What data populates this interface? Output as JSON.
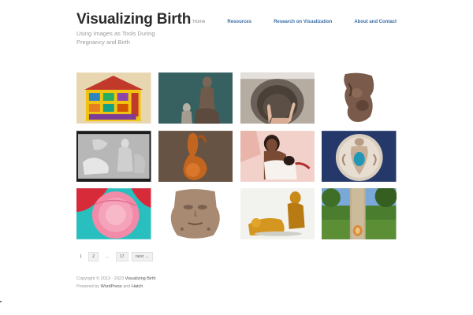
{
  "site": {
    "title": "Visualizing Birth",
    "tagline": "Using Images as Tools During Pregnancy and Birth"
  },
  "nav": {
    "items": [
      {
        "label": "Home"
      },
      {
        "label": "Resources"
      },
      {
        "label": "Research on Visualization"
      },
      {
        "label": "About and Contact"
      }
    ]
  },
  "gallery": {
    "images": [
      {
        "name": "colorful-folk-house-painting"
      },
      {
        "name": "figure-sculptures-teal-background"
      },
      {
        "name": "hand-and-clay-vessel"
      },
      {
        "name": "carved-wooden-torso"
      },
      {
        "name": "stone-relief-carving"
      },
      {
        "name": "polished-wood-abstract-figure"
      },
      {
        "name": "painted-breastfeeding-mother"
      },
      {
        "name": "ceramic-plate-figure-blue-center"
      },
      {
        "name": "pink-circle-painting"
      },
      {
        "name": "carved-stone-head-vessel"
      },
      {
        "name": "gold-figures-sculpture"
      },
      {
        "name": "totem-pole-outdoors"
      }
    ]
  },
  "pagination": {
    "p1": "1",
    "p2": "2",
    "ellipsis": "…",
    "last": "17",
    "next": "next →"
  },
  "footer": {
    "copyright_prefix": "Copyright © 2013 - 2023",
    "site_name": "Visualizing Birth",
    "powered_prefix": "Powered by",
    "platform": "WordPress",
    "and": "and",
    "theme": "Hatch",
    "suffix": "."
  }
}
